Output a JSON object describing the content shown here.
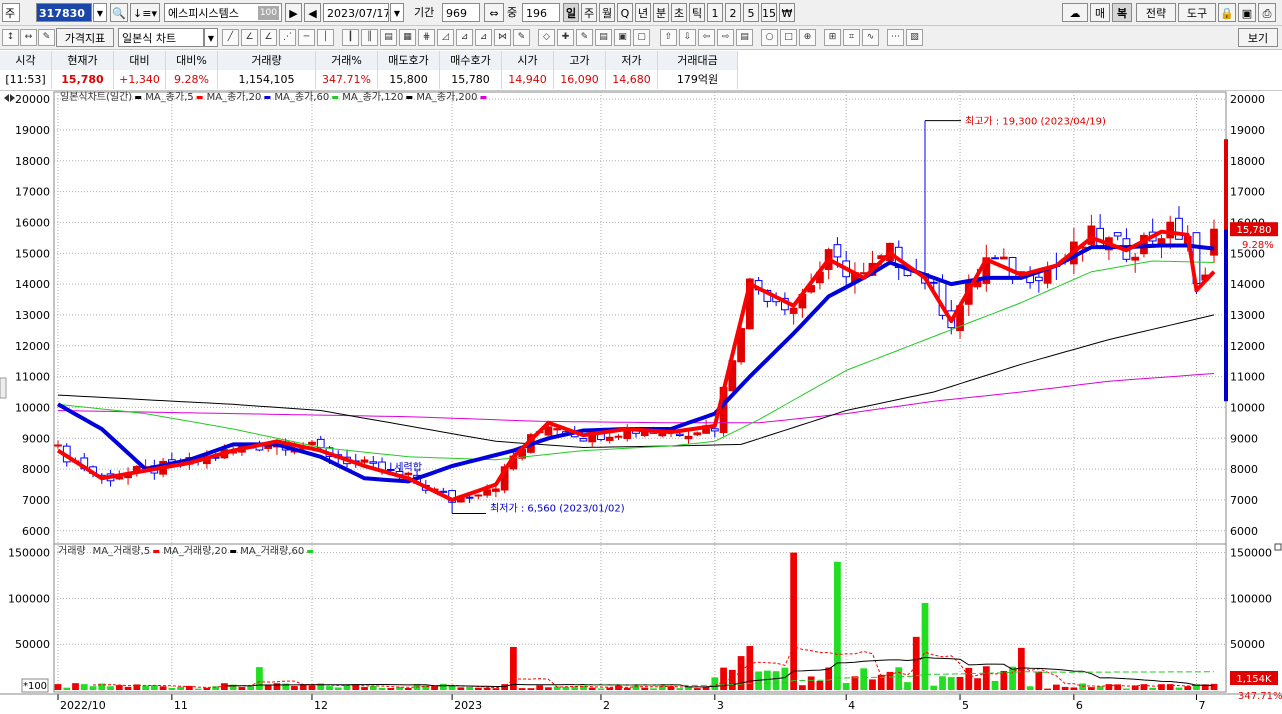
{
  "toolbar": {
    "market": "주",
    "code": "317830",
    "name": "에스피시스템스",
    "name_badge": "100",
    "date": "2023/07/17",
    "period_label": "기간",
    "period_value": "969",
    "count_label": "중",
    "count_value": "196",
    "interval_buttons": [
      "일",
      "주",
      "월",
      "Q",
      "년",
      "분",
      "초",
      "틱",
      "1",
      "2",
      "5",
      "15",
      "₩"
    ],
    "active_interval": "일",
    "right_buttons": [
      "매",
      "복",
      "전략",
      "도구"
    ],
    "price_index": "가격지표",
    "chart_type": "일본식 차트",
    "view_button": "보기"
  },
  "quote": {
    "headers": [
      "시각",
      "현재가",
      "대비",
      "대비%",
      "거래량",
      "거래%",
      "매도호가",
      "매수호가",
      "시가",
      "고가",
      "저가",
      "거래대금"
    ],
    "values": [
      "[11:53]",
      "15,780",
      "+1,340",
      "9.28%",
      "1,154,105",
      "347.71%",
      "15,800",
      "15,780",
      "14,940",
      "16,090",
      "14,680",
      "179억원"
    ]
  },
  "colors": {
    "up": "#e00000",
    "down": "#0000ff",
    "ma5": "#ff0000",
    "ma20": "#0000dd",
    "ma60": "#22cc22",
    "ma120": "#000000",
    "ma200": "#dd00dd",
    "vol_up": "#ee0000",
    "vol_down": "#22dd22"
  },
  "chart_data": {
    "type": "candlestick",
    "price_panel": {
      "legend": [
        {
          "text": "일본식차트(일간)",
          "color": "#000000"
        },
        {
          "text": "MA_종가,5",
          "color": "#ff0000"
        },
        {
          "text": "MA_종가,20",
          "color": "#0000dd"
        },
        {
          "text": "MA_종가,60",
          "color": "#22cc22"
        },
        {
          "text": "MA_종가,120",
          "color": "#000000"
        },
        {
          "text": "MA_종가,200",
          "color": "#dd00dd"
        }
      ],
      "ylim": [
        5700,
        20100
      ],
      "yticks": [
        6000,
        7000,
        8000,
        9000,
        10000,
        11000,
        12000,
        13000,
        14000,
        15000,
        16000,
        17000,
        18000,
        19000,
        20000
      ],
      "close_path": [
        [
          0,
          8600
        ],
        [
          5,
          7700
        ],
        [
          10,
          7950
        ],
        [
          15,
          8200
        ],
        [
          20,
          8600
        ],
        [
          25,
          8900
        ],
        [
          30,
          8600
        ],
        [
          35,
          8100
        ],
        [
          40,
          7700
        ],
        [
          45,
          7000
        ],
        [
          50,
          7500
        ],
        [
          52,
          8400
        ],
        [
          56,
          9500
        ],
        [
          60,
          9100
        ],
        [
          65,
          9300
        ],
        [
          70,
          9200
        ],
        [
          75,
          9400
        ],
        [
          79,
          14000
        ],
        [
          84,
          13300
        ],
        [
          88,
          14800
        ],
        [
          92,
          14200
        ],
        [
          95,
          15000
        ],
        [
          99,
          14200
        ],
        [
          102,
          12800
        ],
        [
          106,
          14800
        ],
        [
          110,
          14300
        ],
        [
          114,
          14600
        ],
        [
          118,
          15500
        ],
        [
          122,
          15100
        ],
        [
          126,
          15700
        ],
        [
          129,
          15600
        ],
        [
          130,
          13800
        ],
        [
          132,
          14400
        ]
      ],
      "ma20_path": [
        [
          0,
          10100
        ],
        [
          5,
          9300
        ],
        [
          10,
          8000
        ],
        [
          15,
          8300
        ],
        [
          20,
          8800
        ],
        [
          25,
          8800
        ],
        [
          30,
          8400
        ],
        [
          35,
          7700
        ],
        [
          40,
          7600
        ],
        [
          45,
          8100
        ],
        [
          52,
          8600
        ],
        [
          56,
          9000
        ],
        [
          60,
          9250
        ],
        [
          65,
          9300
        ],
        [
          70,
          9300
        ],
        [
          75,
          9800
        ],
        [
          79,
          11000
        ],
        [
          84,
          12400
        ],
        [
          88,
          13600
        ],
        [
          92,
          14200
        ],
        [
          95,
          14700
        ],
        [
          99,
          14300
        ],
        [
          102,
          14000
        ],
        [
          106,
          14200
        ],
        [
          110,
          14200
        ],
        [
          114,
          14600
        ],
        [
          118,
          15200
        ],
        [
          122,
          15200
        ],
        [
          126,
          15250
        ],
        [
          129,
          15250
        ],
        [
          132,
          15150
        ]
      ],
      "ma60_path": [
        [
          0,
          10100
        ],
        [
          10,
          9800
        ],
        [
          20,
          9300
        ],
        [
          30,
          8700
        ],
        [
          40,
          8400
        ],
        [
          50,
          8300
        ],
        [
          60,
          8600
        ],
        [
          70,
          8750
        ],
        [
          75,
          8900
        ],
        [
          80,
          9600
        ],
        [
          90,
          11200
        ],
        [
          100,
          12300
        ],
        [
          110,
          13400
        ],
        [
          118,
          14400
        ],
        [
          125,
          14750
        ],
        [
          132,
          14700
        ]
      ],
      "ma120_path": [
        [
          0,
          10400
        ],
        [
          20,
          10100
        ],
        [
          30,
          9900
        ],
        [
          40,
          9400
        ],
        [
          50,
          8900
        ],
        [
          60,
          8700
        ],
        [
          70,
          8750
        ],
        [
          78,
          8800
        ],
        [
          90,
          9900
        ],
        [
          100,
          10500
        ],
        [
          110,
          11400
        ],
        [
          120,
          12200
        ],
        [
          132,
          13000
        ]
      ],
      "ma200_path": [
        [
          0,
          9900
        ],
        [
          20,
          9800
        ],
        [
          40,
          9700
        ],
        [
          55,
          9550
        ],
        [
          70,
          9500
        ],
        [
          80,
          9500
        ],
        [
          90,
          9800
        ],
        [
          100,
          10200
        ],
        [
          110,
          10500
        ],
        [
          120,
          10850
        ],
        [
          132,
          11100
        ]
      ],
      "high_label": "최고가 : 19,300 (2023/04/19)",
      "high_value": 19300,
      "high_index": 99,
      "low_label": "최저가 : 6,560 (2023/01/02)",
      "low_value": 6560,
      "low_index": 45,
      "last_price": "15,780",
      "last_pct": "9.28%",
      "overlap_text": "세력합"
    },
    "volume_panel": {
      "legend": [
        {
          "text": "거래량",
          "color": "#000000"
        },
        {
          "text": "MA_거래량,5",
          "color": "#ff0000"
        },
        {
          "text": "MA_거래량,20",
          "color": "#000000"
        },
        {
          "text": "MA_거래량,60",
          "color": "#22cc22"
        }
      ],
      "ylim": [
        0,
        155000
      ],
      "yticks": [
        50000,
        100000,
        150000
      ],
      "ytick_labels": [
        "50000",
        "100000",
        "150000"
      ],
      "unit": "*100",
      "spikes": [
        [
          23,
          25000
        ],
        [
          52,
          47000
        ],
        [
          78,
          37000
        ],
        [
          79,
          48000
        ],
        [
          84,
          150000
        ],
        [
          89,
          140000
        ],
        [
          98,
          58000
        ],
        [
          99,
          95000
        ],
        [
          110,
          46000
        ]
      ],
      "last_volume": "1,154K",
      "last_pct": "347.71%"
    },
    "x_labels": [
      "2022/10",
      "11",
      "12",
      "2023",
      "2",
      "3",
      "4",
      "5",
      "6",
      "7"
    ],
    "x_label_index": [
      0,
      13,
      29,
      45,
      62,
      75,
      90,
      103,
      116,
      130
    ],
    "bars": 133
  }
}
